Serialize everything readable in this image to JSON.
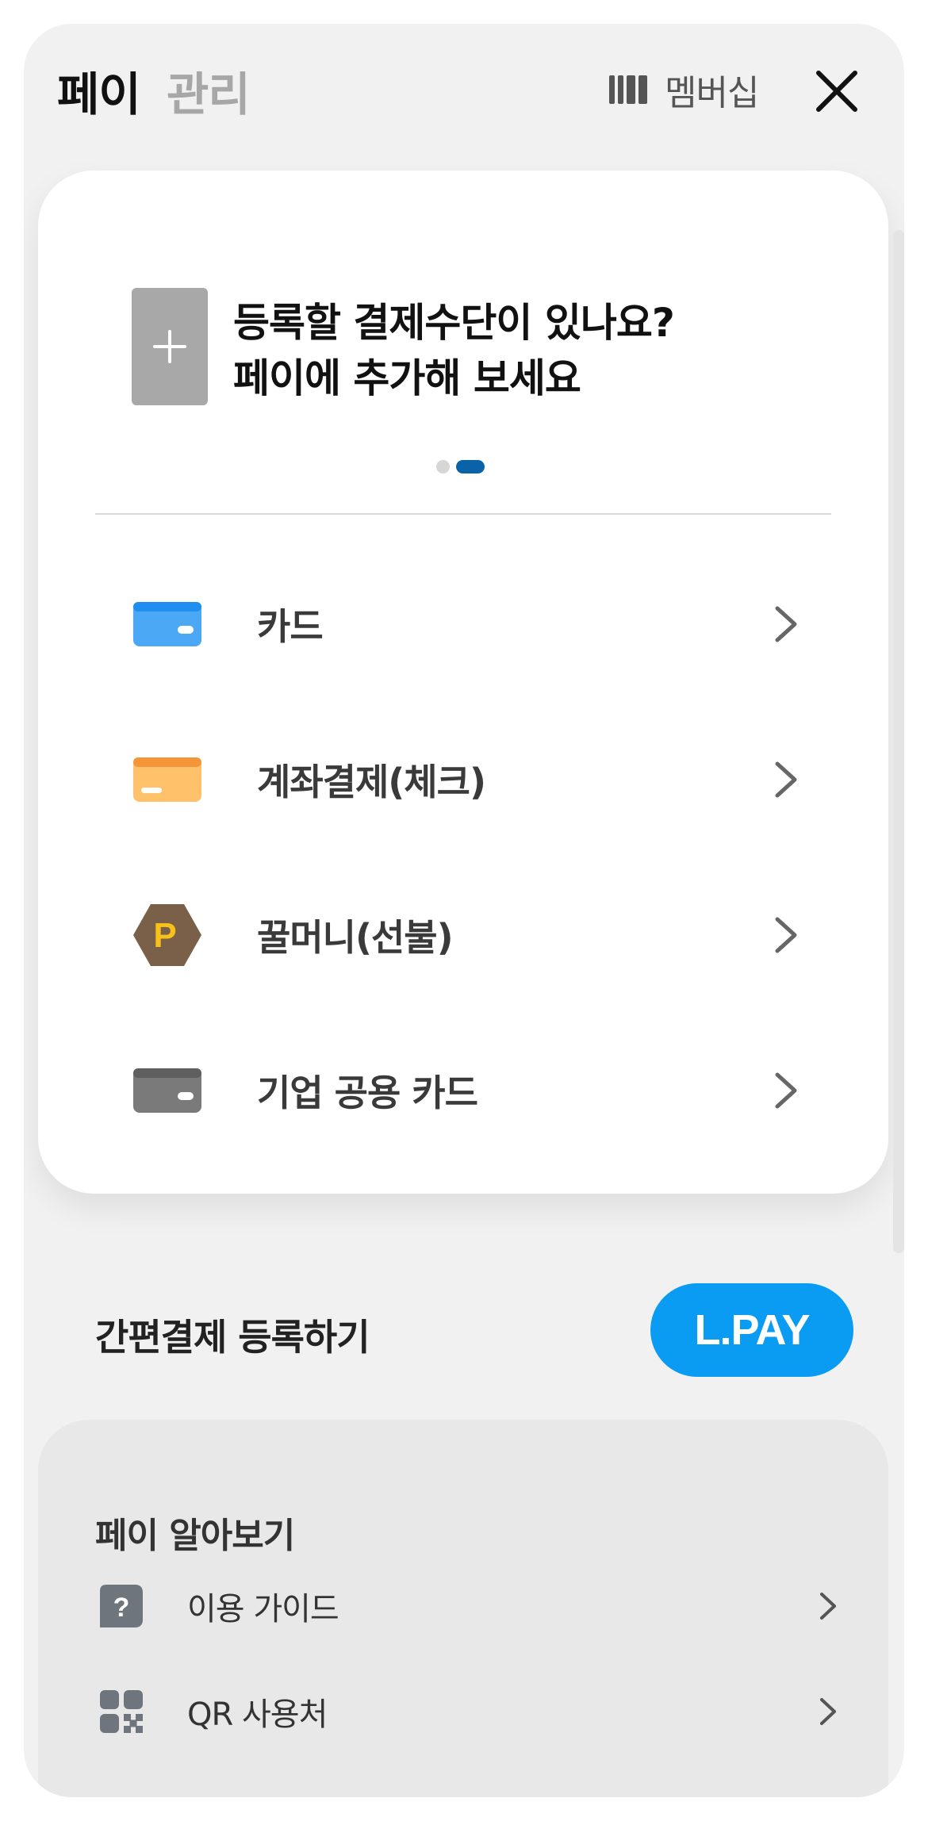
{
  "header": {
    "tab_pay": "페이",
    "tab_manage": "관리",
    "membership_label": "멤버십",
    "membership_icon": "barcode-icon",
    "close_icon": "close-icon"
  },
  "promo": {
    "line1": "등록할 결제수단이 있나요?",
    "line2": "페이에 추가해 보세요",
    "icon": "plus-icon",
    "pager": {
      "count": 2,
      "active_index": 1
    }
  },
  "methods": [
    {
      "label": "카드",
      "icon": "card-icon",
      "color": "#4aa8f5"
    },
    {
      "label": "계좌결제(체크)",
      "icon": "account-card-icon",
      "color": "#ffc26b"
    },
    {
      "label": "꿀머니(선불)",
      "icon": "honey-money-icon",
      "color": "#7a6048"
    },
    {
      "label": "기업 공용 카드",
      "icon": "corporate-card-icon",
      "color": "#7a7a7a"
    }
  ],
  "quick_pay": {
    "label": "간편결제 등록하기",
    "button_label": "L.PAY",
    "button_color": "#0a9bf3"
  },
  "learn": {
    "title": "페이 알아보기",
    "items": [
      {
        "label": "이용 가이드",
        "icon": "question-icon"
      },
      {
        "label": "QR 사용처",
        "icon": "qr-code-icon"
      }
    ]
  },
  "colors": {
    "accent": "#0a63a8",
    "background": "#f1f1f1"
  }
}
